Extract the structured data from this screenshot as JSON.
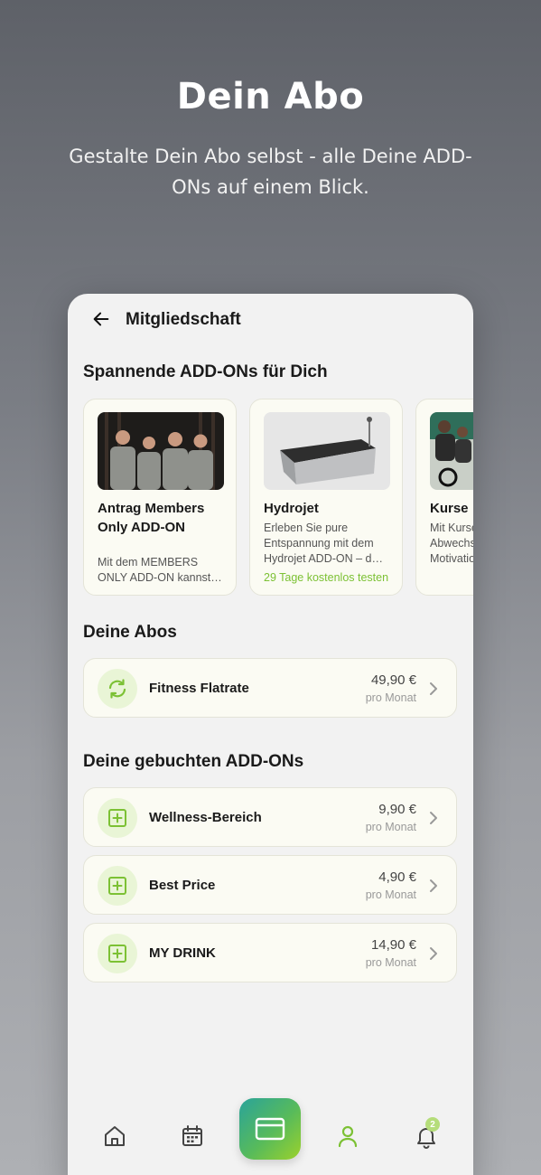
{
  "hero": {
    "title": "Dein Abo",
    "subtitle": "Gestalte Dein Abo selbst - alle Deine ADD-ONs auf einem Blick."
  },
  "appbar": {
    "title": "Mitgliedschaft",
    "back_icon": "arrow-left-icon"
  },
  "addons_section": {
    "title": "Spannende ADD-ONs für Dich",
    "cards": [
      {
        "title": "Antrag Members Only ADD-ON",
        "description": "Mit dem MEMBERS ONLY ADD-ON kannst…",
        "trial": ""
      },
      {
        "title": "Hydrojet",
        "description": "Erleben Sie pure Entspannung mit dem Hydrojet ADD-ON – d…",
        "trial": "29 Tage kostenlos testen"
      },
      {
        "title": "Kurse",
        "description": "Mit Kursen mehr Abwechslung und Motivation",
        "trial": ""
      }
    ]
  },
  "abos_section": {
    "title": "Deine Abos",
    "items": [
      {
        "name": "Fitness Flatrate",
        "price": "49,90 €",
        "period": "pro Monat",
        "icon": "refresh-icon"
      }
    ]
  },
  "booked_section": {
    "title": "Deine gebuchten ADD-ONs",
    "items": [
      {
        "name": "Wellness-Bereich",
        "price": "9,90 €",
        "period": "pro Monat",
        "icon": "plus-square-icon"
      },
      {
        "name": "Best Price",
        "price": "4,90 €",
        "period": "pro Monat",
        "icon": "plus-square-icon"
      },
      {
        "name": "MY DRINK",
        "price": "14,90 €",
        "period": "pro Monat",
        "icon": "plus-square-icon"
      }
    ]
  },
  "bottom_nav": {
    "notification_count": "2",
    "items": [
      "home-icon",
      "calendar-icon",
      "card-icon",
      "profile-icon",
      "bell-icon"
    ]
  },
  "colors": {
    "accent_green": "#7cc134",
    "icon_bg": "#e9f5d6",
    "card_bg": "#fbfbf3"
  }
}
